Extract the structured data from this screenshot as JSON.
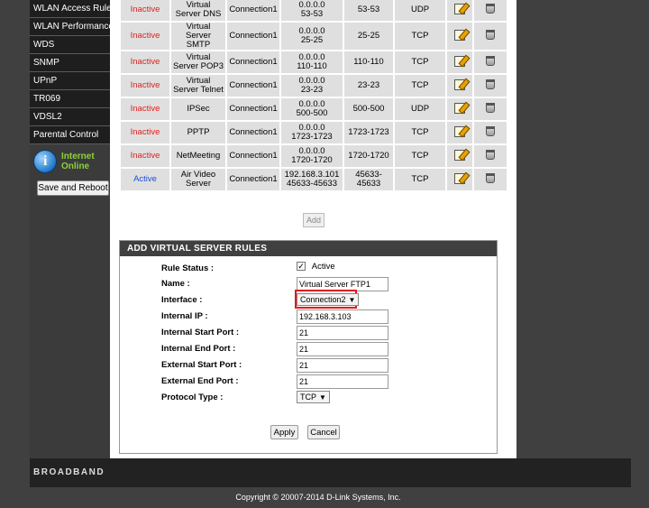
{
  "sidebar": {
    "items": [
      {
        "label": "WLAN Access Rules"
      },
      {
        "label": "WLAN Performance"
      },
      {
        "label": "WDS"
      },
      {
        "label": "SNMP"
      },
      {
        "label": "UPnP"
      },
      {
        "label": "TR069"
      },
      {
        "label": "VDSL2"
      },
      {
        "label": "Parental Control"
      }
    ],
    "status_line1": "Internet",
    "status_line2": "Online",
    "save_reboot_label": "Save and Reboot"
  },
  "rules": [
    {
      "status": "Inactive",
      "name": "Virtual Server DNS",
      "interface": "Connection1",
      "ip": "0.0.0.0",
      "ports": "53-53",
      "port_range": "53-53",
      "protocol": "UDP"
    },
    {
      "status": "Inactive",
      "name": "Virtual Server SMTP",
      "interface": "Connection1",
      "ip": "0.0.0.0",
      "ports": "25-25",
      "port_range": "25-25",
      "protocol": "TCP"
    },
    {
      "status": "Inactive",
      "name": "Virtual Server POP3",
      "interface": "Connection1",
      "ip": "0.0.0.0",
      "ports": "110-110",
      "port_range": "110-110",
      "protocol": "TCP"
    },
    {
      "status": "Inactive",
      "name": "Virtual Server Telnet",
      "interface": "Connection1",
      "ip": "0.0.0.0",
      "ports": "23-23",
      "port_range": "23-23",
      "protocol": "TCP"
    },
    {
      "status": "Inactive",
      "name": "IPSec",
      "interface": "Connection1",
      "ip": "0.0.0.0",
      "ports": "500-500",
      "port_range": "500-500",
      "protocol": "UDP"
    },
    {
      "status": "Inactive",
      "name": "PPTP",
      "interface": "Connection1",
      "ip": "0.0.0.0",
      "ports": "1723-1723",
      "port_range": "1723-1723",
      "protocol": "TCP"
    },
    {
      "status": "Inactive",
      "name": "NetMeeting",
      "interface": "Connection1",
      "ip": "0.0.0.0",
      "ports": "1720-1720",
      "port_range": "1720-1720",
      "protocol": "TCP"
    },
    {
      "status": "Active",
      "name": "Air Video Server",
      "interface": "Connection1",
      "ip": "192.168.3.101",
      "ports": "45633-45633",
      "port_range": "45633-45633",
      "protocol": "TCP"
    }
  ],
  "add_label": "Add",
  "form": {
    "header": "ADD VIRTUAL SERVER RULES",
    "rule_status_label": "Rule Status :",
    "rule_status_value": "Active",
    "name_label": "Name :",
    "name_value": "Virtual Server FTP1",
    "interface_label": "Interface :",
    "interface_value": "Connection2",
    "internal_ip_label": "Internal IP :",
    "internal_ip_value": "192.168.3.103",
    "internal_start_label": "Internal Start Port :",
    "internal_start_value": "21",
    "internal_end_label": "Internal End Port :",
    "internal_end_value": "21",
    "external_start_label": "External Start Port :",
    "external_start_value": "21",
    "external_end_label": "External End Port :",
    "external_end_value": "21",
    "protocol_label": "Protocol Type :",
    "protocol_value": "TCP",
    "apply_label": "Apply",
    "cancel_label": "Cancel"
  },
  "footer": {
    "brand": "BROADBAND",
    "copyright": "Copyright © 20007-2014 D-Link Systems, Inc."
  },
  "colors": {
    "inactive": "#e02020",
    "active": "#1d4fd6",
    "highlight": "#e01a1a"
  }
}
